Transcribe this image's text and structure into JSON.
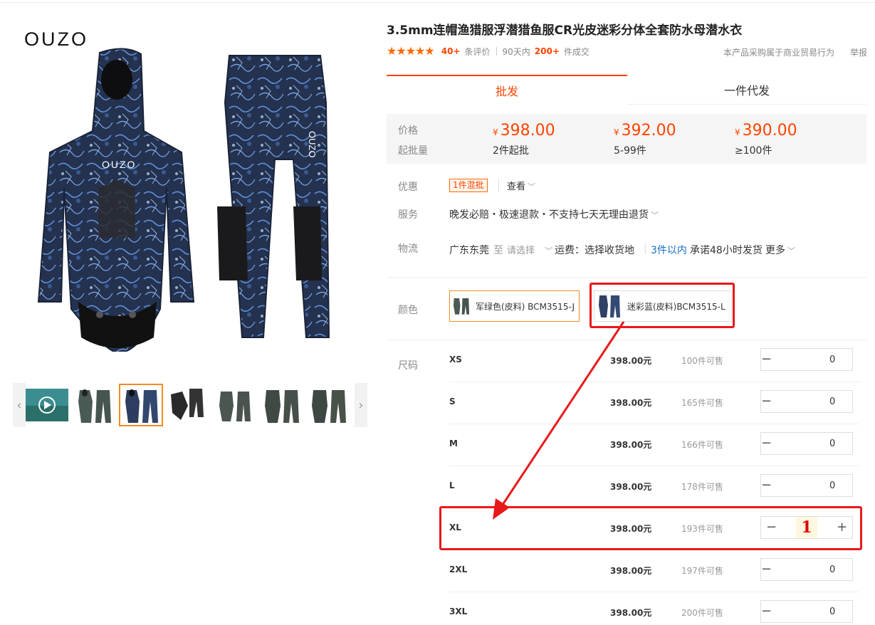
{
  "brand": "OUZO",
  "product": {
    "title": "3.5mm连帽渔猎服浮潜猎鱼服CR光皮迷彩分体全套防水母潜水衣",
    "reviews_count": "40+",
    "reviews_label": "条评价",
    "sales_period": "90天内",
    "sales_count": "200+",
    "sales_label": "件成交",
    "commercial_note": "本产品采购属于商业贸易行为",
    "report_link": "举报",
    "rating_stars": 5
  },
  "tabs": [
    {
      "label": "批发",
      "active": true
    },
    {
      "label": "一件代发",
      "active": false
    }
  ],
  "price_tiers": {
    "price_label": "价格",
    "min_qty_label": "起批量",
    "currency": "¥",
    "tiers": [
      {
        "price": "398.00",
        "qty": "2件起批"
      },
      {
        "price": "392.00",
        "qty": "5-99件"
      },
      {
        "price": "390.00",
        "qty": "≥100件"
      }
    ]
  },
  "info": {
    "promo_label": "优惠",
    "promo_tag": "1件混批",
    "promo_look": "查看",
    "service_label": "服务",
    "service_text": "晚发必赔・极速退款・不支持七天无理由退货",
    "logistics_label": "物流",
    "origin": "广东东莞",
    "to": "至",
    "dest_placeholder": "请选择",
    "freight": "运费：选择收货地",
    "ship_highlight": "3件以内",
    "ship_promise": "承诺48小时发货",
    "more": "更多"
  },
  "color": {
    "label": "颜色",
    "options": [
      {
        "label": "军绿色(皮料) BCM3515-J",
        "selected": true
      },
      {
        "label": "迷彩蓝(皮料)BCM3515-L",
        "selected": false
      }
    ]
  },
  "size": {
    "label": "尺码",
    "rows": [
      {
        "name": "XS",
        "price": "398.00元",
        "avail": "100件可售",
        "qty": "0"
      },
      {
        "name": "S",
        "price": "398.00元",
        "avail": "165件可售",
        "qty": "0"
      },
      {
        "name": "M",
        "price": "398.00元",
        "avail": "166件可售",
        "qty": "0"
      },
      {
        "name": "L",
        "price": "398.00元",
        "avail": "178件可售",
        "qty": "0"
      },
      {
        "name": "XL",
        "price": "398.00元",
        "avail": "193件可售",
        "qty": "1"
      },
      {
        "name": "2XL",
        "price": "398.00元",
        "avail": "197件可售",
        "qty": "0"
      },
      {
        "name": "3XL",
        "price": "398.00元",
        "avail": "200件可售",
        "qty": "0"
      }
    ]
  },
  "stepper": {
    "minus": "−",
    "plus": "+"
  },
  "colors": {
    "accent": "#ff4400",
    "annotation": "#e8191a",
    "selected_border": "#f48c1f"
  },
  "icons": {
    "star": "star-icon",
    "chevron": "chevron-down-icon",
    "play": "play-icon",
    "arrow_left": "arrow-left-icon",
    "arrow_right": "arrow-right-icon"
  }
}
